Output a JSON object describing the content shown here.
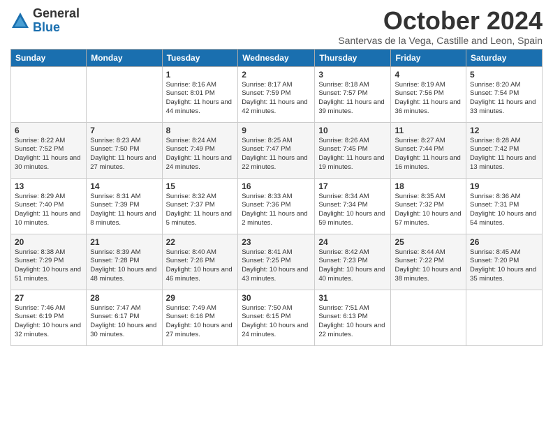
{
  "header": {
    "logo_general": "General",
    "logo_blue": "Blue",
    "month_title": "October 2024",
    "subtitle": "Santervas de la Vega, Castille and Leon, Spain"
  },
  "weekdays": [
    "Sunday",
    "Monday",
    "Tuesday",
    "Wednesday",
    "Thursday",
    "Friday",
    "Saturday"
  ],
  "weeks": [
    [
      {
        "day": "",
        "info": ""
      },
      {
        "day": "",
        "info": ""
      },
      {
        "day": "1",
        "info": "Sunrise: 8:16 AM\nSunset: 8:01 PM\nDaylight: 11 hours and 44 minutes."
      },
      {
        "day": "2",
        "info": "Sunrise: 8:17 AM\nSunset: 7:59 PM\nDaylight: 11 hours and 42 minutes."
      },
      {
        "day": "3",
        "info": "Sunrise: 8:18 AM\nSunset: 7:57 PM\nDaylight: 11 hours and 39 minutes."
      },
      {
        "day": "4",
        "info": "Sunrise: 8:19 AM\nSunset: 7:56 PM\nDaylight: 11 hours and 36 minutes."
      },
      {
        "day": "5",
        "info": "Sunrise: 8:20 AM\nSunset: 7:54 PM\nDaylight: 11 hours and 33 minutes."
      }
    ],
    [
      {
        "day": "6",
        "info": "Sunrise: 8:22 AM\nSunset: 7:52 PM\nDaylight: 11 hours and 30 minutes."
      },
      {
        "day": "7",
        "info": "Sunrise: 8:23 AM\nSunset: 7:50 PM\nDaylight: 11 hours and 27 minutes."
      },
      {
        "day": "8",
        "info": "Sunrise: 8:24 AM\nSunset: 7:49 PM\nDaylight: 11 hours and 24 minutes."
      },
      {
        "day": "9",
        "info": "Sunrise: 8:25 AM\nSunset: 7:47 PM\nDaylight: 11 hours and 22 minutes."
      },
      {
        "day": "10",
        "info": "Sunrise: 8:26 AM\nSunset: 7:45 PM\nDaylight: 11 hours and 19 minutes."
      },
      {
        "day": "11",
        "info": "Sunrise: 8:27 AM\nSunset: 7:44 PM\nDaylight: 11 hours and 16 minutes."
      },
      {
        "day": "12",
        "info": "Sunrise: 8:28 AM\nSunset: 7:42 PM\nDaylight: 11 hours and 13 minutes."
      }
    ],
    [
      {
        "day": "13",
        "info": "Sunrise: 8:29 AM\nSunset: 7:40 PM\nDaylight: 11 hours and 10 minutes."
      },
      {
        "day": "14",
        "info": "Sunrise: 8:31 AM\nSunset: 7:39 PM\nDaylight: 11 hours and 8 minutes."
      },
      {
        "day": "15",
        "info": "Sunrise: 8:32 AM\nSunset: 7:37 PM\nDaylight: 11 hours and 5 minutes."
      },
      {
        "day": "16",
        "info": "Sunrise: 8:33 AM\nSunset: 7:36 PM\nDaylight: 11 hours and 2 minutes."
      },
      {
        "day": "17",
        "info": "Sunrise: 8:34 AM\nSunset: 7:34 PM\nDaylight: 10 hours and 59 minutes."
      },
      {
        "day": "18",
        "info": "Sunrise: 8:35 AM\nSunset: 7:32 PM\nDaylight: 10 hours and 57 minutes."
      },
      {
        "day": "19",
        "info": "Sunrise: 8:36 AM\nSunset: 7:31 PM\nDaylight: 10 hours and 54 minutes."
      }
    ],
    [
      {
        "day": "20",
        "info": "Sunrise: 8:38 AM\nSunset: 7:29 PM\nDaylight: 10 hours and 51 minutes."
      },
      {
        "day": "21",
        "info": "Sunrise: 8:39 AM\nSunset: 7:28 PM\nDaylight: 10 hours and 48 minutes."
      },
      {
        "day": "22",
        "info": "Sunrise: 8:40 AM\nSunset: 7:26 PM\nDaylight: 10 hours and 46 minutes."
      },
      {
        "day": "23",
        "info": "Sunrise: 8:41 AM\nSunset: 7:25 PM\nDaylight: 10 hours and 43 minutes."
      },
      {
        "day": "24",
        "info": "Sunrise: 8:42 AM\nSunset: 7:23 PM\nDaylight: 10 hours and 40 minutes."
      },
      {
        "day": "25",
        "info": "Sunrise: 8:44 AM\nSunset: 7:22 PM\nDaylight: 10 hours and 38 minutes."
      },
      {
        "day": "26",
        "info": "Sunrise: 8:45 AM\nSunset: 7:20 PM\nDaylight: 10 hours and 35 minutes."
      }
    ],
    [
      {
        "day": "27",
        "info": "Sunrise: 7:46 AM\nSunset: 6:19 PM\nDaylight: 10 hours and 32 minutes."
      },
      {
        "day": "28",
        "info": "Sunrise: 7:47 AM\nSunset: 6:17 PM\nDaylight: 10 hours and 30 minutes."
      },
      {
        "day": "29",
        "info": "Sunrise: 7:49 AM\nSunset: 6:16 PM\nDaylight: 10 hours and 27 minutes."
      },
      {
        "day": "30",
        "info": "Sunrise: 7:50 AM\nSunset: 6:15 PM\nDaylight: 10 hours and 24 minutes."
      },
      {
        "day": "31",
        "info": "Sunrise: 7:51 AM\nSunset: 6:13 PM\nDaylight: 10 hours and 22 minutes."
      },
      {
        "day": "",
        "info": ""
      },
      {
        "day": "",
        "info": ""
      }
    ]
  ]
}
